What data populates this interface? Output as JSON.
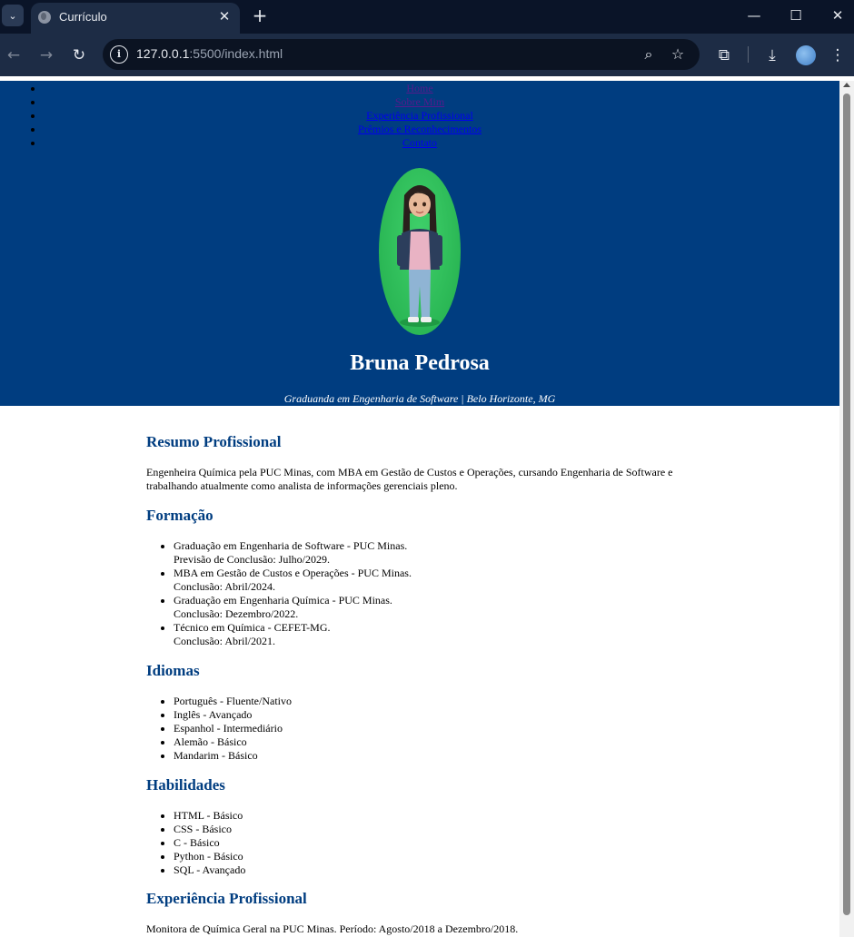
{
  "browser": {
    "tab_title": "Currículo",
    "url_host": "127.0.0.1",
    "url_rest": ":5500/index.html"
  },
  "nav": [
    {
      "label": "Home",
      "state": "visited"
    },
    {
      "label": "Sobre Mim",
      "state": "visited"
    },
    {
      "label": "Experiência Profissional",
      "state": "link"
    },
    {
      "label": "Prêmios e Reconhecimentos",
      "state": "link"
    },
    {
      "label": "Contato",
      "state": "link"
    }
  ],
  "hero": {
    "name": "Bruna Pedrosa",
    "tagline": "Graduanda em Engenharia de Software | Belo Horizonte, MG"
  },
  "sections": {
    "resumo": {
      "title": "Resumo Profissional",
      "text": "Engenheira Química pela PUC Minas, com MBA em Gestão de Custos e Operações, cursando Engenharia de Software e trabalhando atualmente como analista de informações gerenciais pleno."
    },
    "formacao": {
      "title": "Formação",
      "items": [
        {
          "course": "Graduação em Engenharia de Software - PUC Minas.",
          "detail": "Previsão de Conclusão: Julho/2029."
        },
        {
          "course": "MBA em Gestão de Custos e Operações - PUC Minas.",
          "detail": "Conclusão: Abril/2024."
        },
        {
          "course": "Graduação em Engenharia Química - PUC Minas.",
          "detail": "Conclusão: Dezembro/2022."
        },
        {
          "course": "Técnico em Química - CEFET-MG.",
          "detail": "Conclusão: Abril/2021."
        }
      ]
    },
    "idiomas": {
      "title": "Idiomas",
      "items": [
        "Português - Fluente/Nativo",
        "Inglês - Avançado",
        "Espanhol - Intermediário",
        "Alemão - Básico",
        "Mandarim - Básico"
      ]
    },
    "habilidades": {
      "title": "Habilidades",
      "items": [
        "HTML - Básico",
        "CSS - Básico",
        "C - Básico",
        "Python - Básico",
        "SQL - Avançado"
      ]
    },
    "experiencia": {
      "title": "Experiência Profissional",
      "text": "Monitora de Química Geral na PUC Minas. Período: Agosto/2018 a Dezembro/2018."
    }
  },
  "colors": {
    "header_bg": "#003d80",
    "heading": "#003d80",
    "tab_bar": "#0a1428",
    "toolbar": "#1d2c45"
  }
}
